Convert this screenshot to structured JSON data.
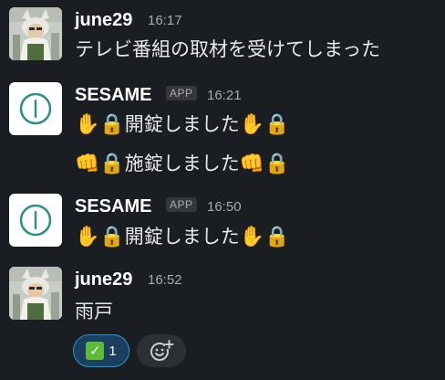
{
  "messages": [
    {
      "author": "june29",
      "time": "16:17",
      "lines": [
        "テレビ番組の取材を受けてしまった"
      ]
    },
    {
      "author": "SESAME",
      "badge": "APP",
      "time": "16:21",
      "lines": [
        {
          "lead": "✋🔒",
          "text": "開錠しました",
          "trail": "✋🔒"
        },
        {
          "lead": "👊🔒",
          "text": "施錠しました",
          "trail": "👊🔒"
        }
      ]
    },
    {
      "author": "SESAME",
      "badge": "APP",
      "time": "16:50",
      "lines": [
        {
          "lead": "✋🔒",
          "text": "開錠しました",
          "trail": "✋🔒"
        }
      ]
    },
    {
      "author": "june29",
      "time": "16:52",
      "lines": [
        "雨戸"
      ],
      "reactions": [
        {
          "emoji": "white-check-mark",
          "count": "1"
        }
      ]
    }
  ],
  "icons": {
    "add_reaction": "add-reaction-icon",
    "app_logo": "sesame-logo-icon"
  },
  "colors": {
    "background": "#1a1d21",
    "reaction_bg": "#1d3f5f",
    "reaction_border": "#1d9bd1",
    "app_accent": "#2d8c8c"
  }
}
